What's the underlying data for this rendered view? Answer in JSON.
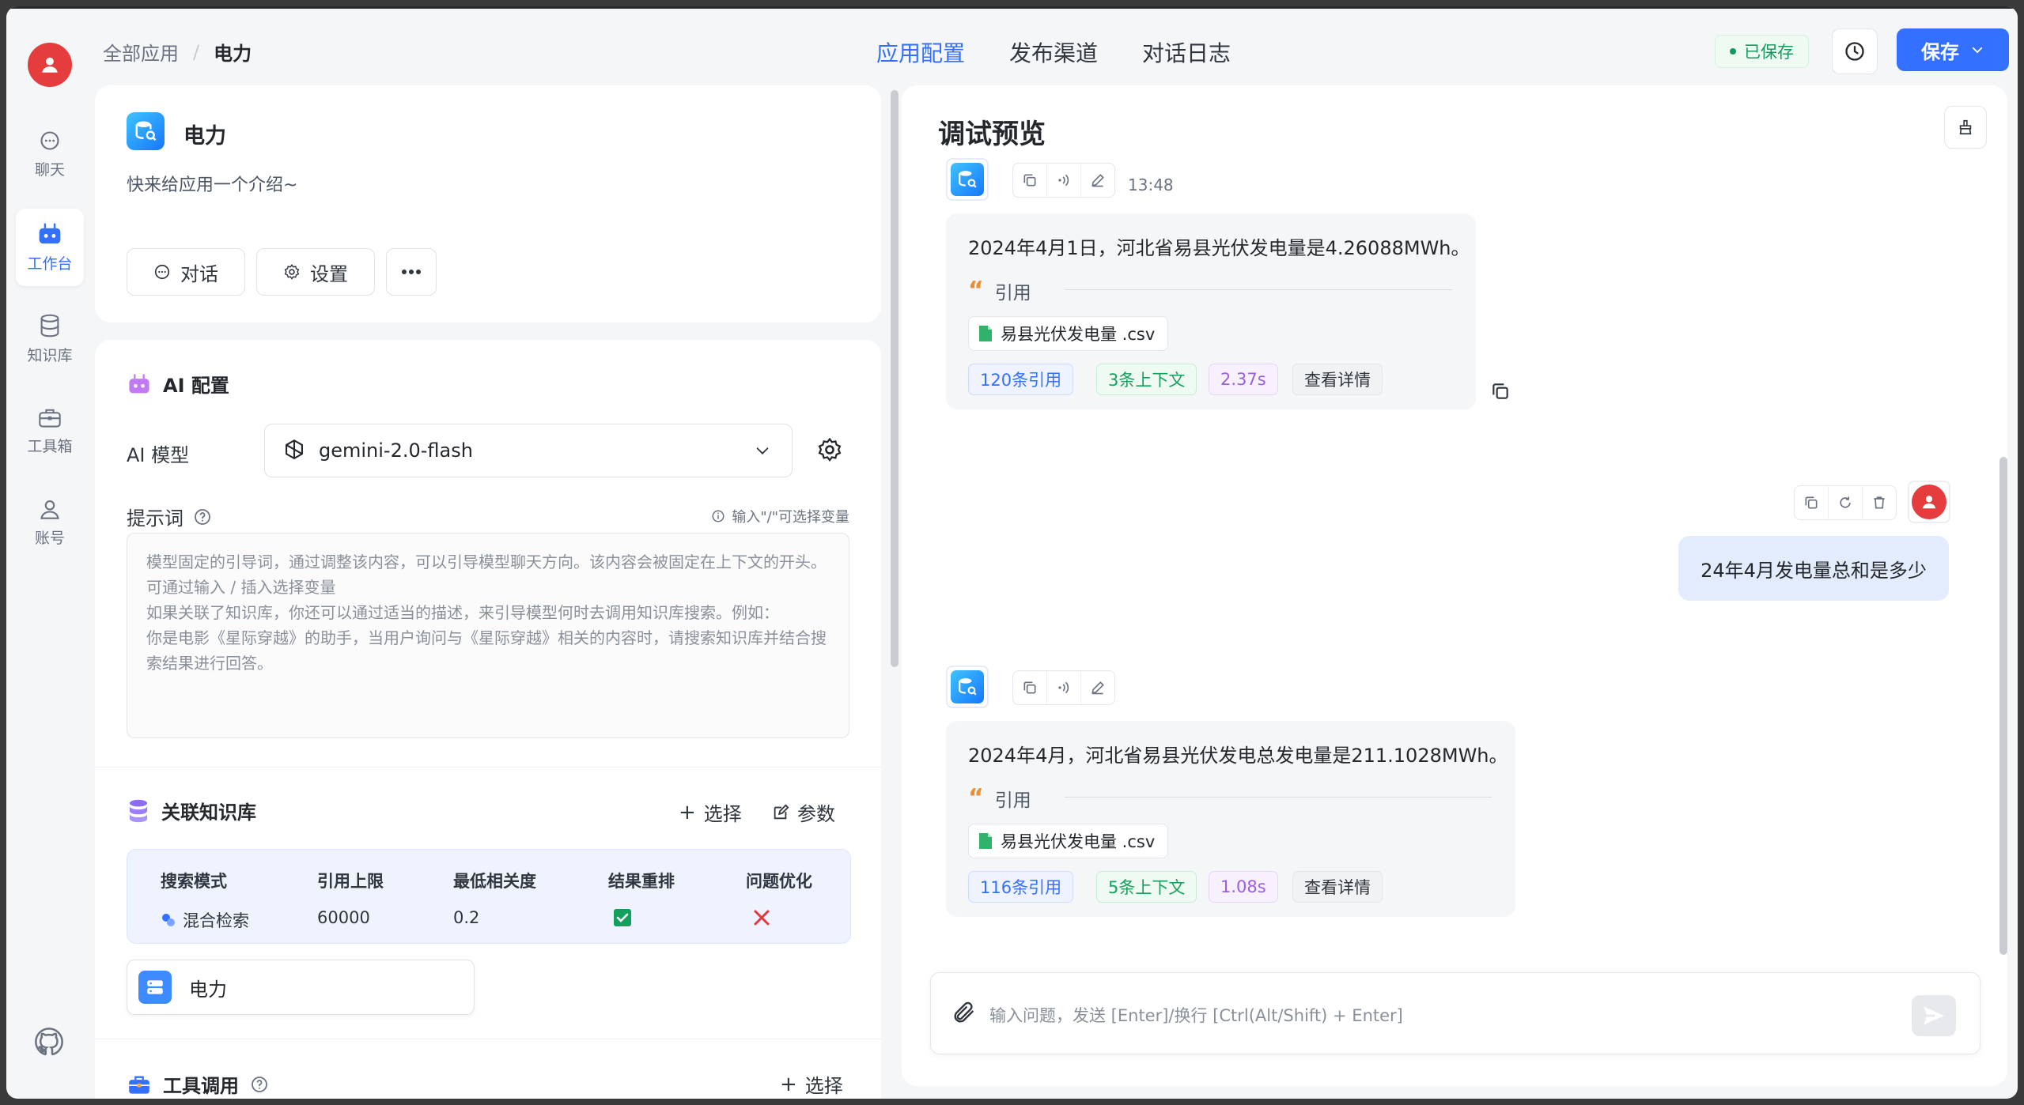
{
  "breadcrumb": {
    "root": "全部应用",
    "current": "电力"
  },
  "tabs": [
    "应用配置",
    "发布渠道",
    "对话日志"
  ],
  "header": {
    "saved_label": "已保存",
    "save_label": "保存"
  },
  "sidebar": {
    "items": [
      {
        "label": "聊天",
        "icon": "chat-icon"
      },
      {
        "label": "工作台",
        "icon": "robot-icon"
      },
      {
        "label": "知识库",
        "icon": "database-icon"
      },
      {
        "label": "工具箱",
        "icon": "toolbox-icon"
      },
      {
        "label": "账号",
        "icon": "user-icon"
      }
    ]
  },
  "app": {
    "name": "电力",
    "intro": "快来给应用一个介绍~",
    "chat_button": "对话",
    "settings_button": "设置"
  },
  "ai_config": {
    "title": "AI 配置",
    "model_label": "AI 模型",
    "model_value": "gemini-2.0-flash",
    "prompt_label": "提示词",
    "prompt_hint": "输入\"/\"可选择变量",
    "prompt_placeholder": "模型固定的引导词，通过调整该内容，可以引导模型聊天方向。该内容会被固定在上下文的开头。可通过输入 / 插入选择变量\n如果关联了知识库，你还可以通过适当的描述，来引导模型何时去调用知识库搜索。例如：\n你是电影《星际穿越》的助手，当用户询问与《星际穿越》相关的内容时，请搜索知识库并结合搜索结果进行回答。"
  },
  "knowledge": {
    "title": "关联知识库",
    "select_label": "选择",
    "params_label": "参数",
    "headers": [
      "搜索模式",
      "引用上限",
      "最低相关度",
      "结果重排",
      "问题优化"
    ],
    "values": {
      "mode": "混合检索",
      "limit": "60000",
      "similarity": "0.2",
      "rerank": true,
      "optimize": false
    },
    "item_name": "电力"
  },
  "tools": {
    "title": "工具调用",
    "select_label": "选择"
  },
  "chat": {
    "title": "调试预览",
    "messages": [
      {
        "role": "ai",
        "time": "13:48",
        "text": "2024年4月1日，河北省易县光伏发电量是4.26088MWh。",
        "quote_label": "引用",
        "file": "易县光伏发电量 .csv",
        "tags": [
          "120条引用",
          "3条上下文",
          "2.37s",
          "查看详情"
        ]
      },
      {
        "role": "user",
        "text": "24年4月发电量总和是多少"
      },
      {
        "role": "ai",
        "text": "2024年4月，河北省易县光伏发电总发电量是211.1028MWh。",
        "quote_label": "引用",
        "file": "易县光伏发电量 .csv",
        "tags": [
          "116条引用",
          "5条上下文",
          "1.08s",
          "查看详情"
        ]
      }
    ],
    "input_placeholder": "输入问题，发送 [Enter]/换行 [Ctrl(Alt/Shift) + Enter]"
  },
  "colors": {
    "accent": "#3370ff",
    "saved": "#13985e",
    "avatar": "#e53d3d"
  }
}
